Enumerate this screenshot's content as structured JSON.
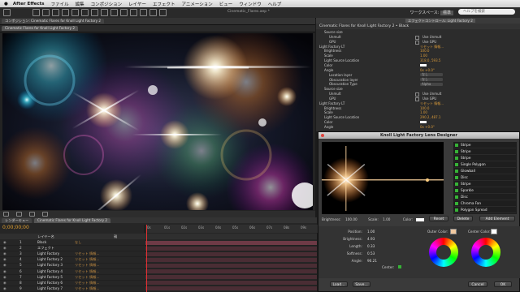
{
  "menubar": {
    "app": "After Effects",
    "items": [
      "ファイル",
      "編集",
      "コンポジション",
      "レイヤー",
      "エフェクト",
      "アニメーション",
      "ビュー",
      "ウィンドウ",
      "ヘルプ"
    ]
  },
  "doc_title": "Cinematic_Flares.aep *",
  "workspace": "ワークスペース:",
  "workspace_value": "標準",
  "search_placeholder": "ヘルプを検索",
  "comp_panel": {
    "tab": "コンポジション: Cinematic Flares for Knoll Light Factory 2",
    "subtab": "Cinematic Flares for Knoll Light Factory 2"
  },
  "effects_panel": {
    "tab": "エフェクトコントロール: Light Factory 2",
    "subtitle": "Cinematic Flares for Knoll Light Factory 2 • Black",
    "rows": [
      {
        "label": "Source size",
        "indent": 1
      },
      {
        "label": "Unmult",
        "indent": 2,
        "check": "Use Unmult"
      },
      {
        "label": "GPU",
        "indent": 2,
        "check": "Use GPU"
      },
      {
        "label": "Light Factory LT",
        "indent": 0,
        "value": "リセット 情報..."
      },
      {
        "label": "Brightness",
        "indent": 1,
        "value": "100.0"
      },
      {
        "label": "Scale",
        "indent": 1,
        "value": "1.00"
      },
      {
        "label": "Light Source Location",
        "indent": 1,
        "value": "318.0, 593.5"
      },
      {
        "label": "Color",
        "indent": 1,
        "swatch": true
      },
      {
        "label": "Angle",
        "indent": 1,
        "value": "0x +0.0°"
      },
      {
        "label": "Location layer",
        "indent": 2,
        "dropdown": "なし"
      },
      {
        "label": "Obscuration layer",
        "indent": 2,
        "dropdown": "なし"
      },
      {
        "label": "Obscuration Type",
        "indent": 2,
        "dropdown": "Alpha"
      },
      {
        "label": "Source size",
        "indent": 1
      },
      {
        "label": "Unmult",
        "indent": 2,
        "check": "Use Unmult"
      },
      {
        "label": "GPU",
        "indent": 2,
        "check": "Use GPU"
      },
      {
        "label": "Light Factory LT",
        "indent": 0,
        "value": "リセット 情報..."
      },
      {
        "label": "Brightness",
        "indent": 1,
        "value": "100.0"
      },
      {
        "label": "Scale",
        "indent": 1,
        "value": "1.00"
      },
      {
        "label": "Light Source Location",
        "indent": 1,
        "value": "290.2, 487.1"
      },
      {
        "label": "Color",
        "indent": 1,
        "swatch": true
      },
      {
        "label": "Angle",
        "indent": 1,
        "value": "0x +0.0°"
      }
    ]
  },
  "timeline": {
    "tab1": "レンダーキュー",
    "tab2": "Cinematic Flares for Knoll Light Factory 2",
    "timecode": "0;00;00;00",
    "ruler_marks": [
      "0s",
      "01s",
      "02s",
      "03s",
      "04s",
      "05s",
      "06s",
      "07s",
      "08s",
      "09s"
    ],
    "header_layer": "レイヤー名",
    "header_parent": "親",
    "layers": [
      {
        "num": "1",
        "name": "Black",
        "parent": "なし"
      },
      {
        "num": "2",
        "name": "エフェクト",
        "parent": ""
      },
      {
        "num": "3",
        "name": "Light Factory",
        "parent": "リセット 情報..."
      },
      {
        "num": "4",
        "name": "Light Factory 2",
        "parent": "リセット 情報..."
      },
      {
        "num": "5",
        "name": "Light Factory 3",
        "parent": "リセット 情報..."
      },
      {
        "num": "6",
        "name": "Light Factory 4",
        "parent": "リセット 情報..."
      },
      {
        "num": "7",
        "name": "Light Factory 5",
        "parent": "リセット 情報..."
      },
      {
        "num": "8",
        "name": "Light Factory 6",
        "parent": "リセット 情報..."
      },
      {
        "num": "9",
        "name": "Light Factory 7",
        "parent": "リセット 情報..."
      }
    ]
  },
  "designer": {
    "title": "Knoll Light Factory Lens Designer",
    "elements": [
      "Stripe",
      "Stripe",
      "Stripe",
      "Single Polygon",
      "Glowball",
      "Disc",
      "Stripe",
      "Sparkle",
      "Disc",
      "Chroma Fan",
      "Polygon Spread"
    ],
    "brightness_label": "Brightness:",
    "brightness_value": "100.00",
    "scale_label": "Scale:",
    "scale_value": "1.00",
    "color_label": "Color:",
    "reset": "Reset",
    "delete": "Delete",
    "add": "Add Element",
    "props": [
      {
        "label": "Position:",
        "value": "1.00"
      },
      {
        "label": "Brightness:",
        "value": "4.93"
      },
      {
        "label": "Length:",
        "value": "0.33"
      },
      {
        "label": "Softness:",
        "value": "0.53"
      },
      {
        "label": "Angle:",
        "value": "90.21"
      }
    ],
    "center_label": "Center:",
    "outer_color": "Outer Color:",
    "center_color": "Center Color:",
    "load": "Load...",
    "save": "Save...",
    "cancel": "Cancel",
    "ok": "OK"
  },
  "colors": {
    "accent": "#e8a33a",
    "green": "#36b336",
    "bar": "#6e3a46",
    "cti": "#e03030"
  }
}
